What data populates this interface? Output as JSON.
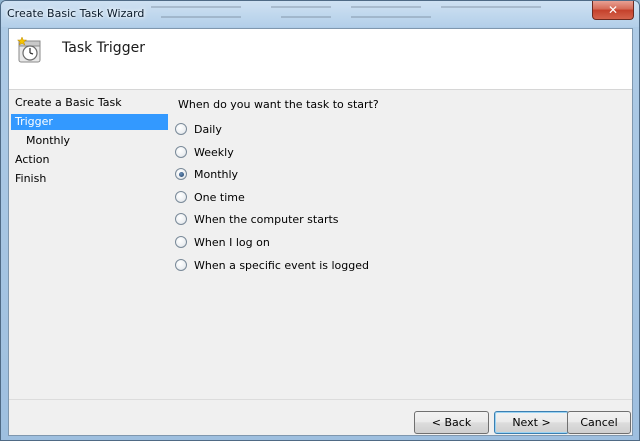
{
  "window": {
    "title": "Create Basic Task Wizard",
    "close_label": "✕"
  },
  "header": {
    "title": "Task Trigger",
    "icon": "clock-task-icon"
  },
  "nav": {
    "items": [
      {
        "label": "Create a Basic Task"
      },
      {
        "label": "Trigger",
        "selected": true
      },
      {
        "label": "Monthly"
      },
      {
        "label": "Action"
      },
      {
        "label": "Finish"
      }
    ]
  },
  "main": {
    "question": "When do you want the task to start?",
    "options": [
      {
        "label": "Daily",
        "checked": false
      },
      {
        "label": "Weekly",
        "checked": false
      },
      {
        "label": "Monthly",
        "checked": true
      },
      {
        "label": "One time",
        "checked": false
      },
      {
        "label": "When the computer starts",
        "checked": false
      },
      {
        "label": "When I log on",
        "checked": false
      },
      {
        "label": "When a specific event is logged",
        "checked": false
      }
    ]
  },
  "footer": {
    "back_label": "< Back",
    "next_label": "Next >",
    "cancel_label": "Cancel"
  },
  "colors": {
    "selection": "#3399ff",
    "close_button": "#c4402b"
  }
}
